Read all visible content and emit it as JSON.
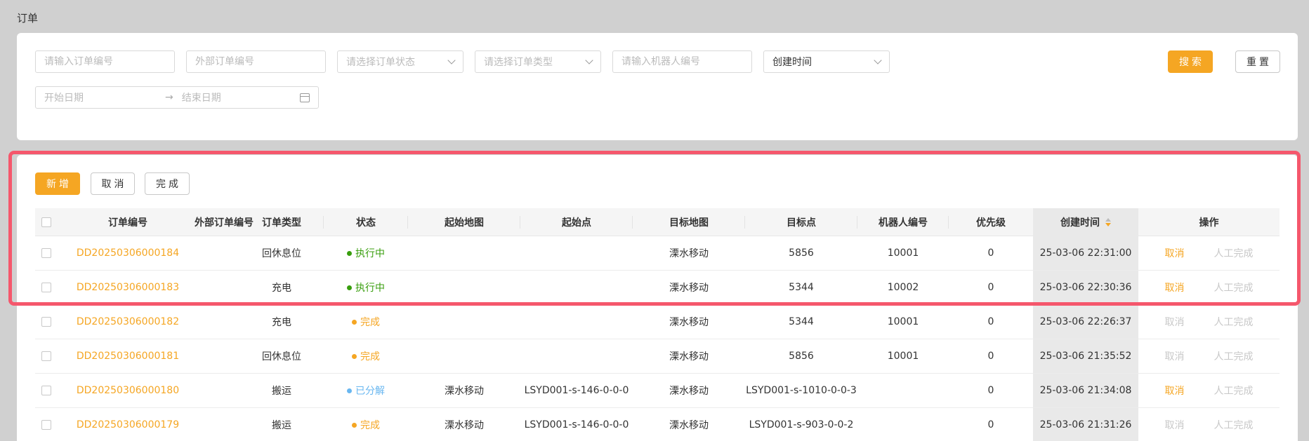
{
  "page_title": "订单",
  "filters": {
    "order_no_placeholder": "请输入订单编号",
    "external_no_placeholder": "外部订单编号",
    "status_placeholder": "请选择订单状态",
    "type_placeholder": "请选择订单类型",
    "robot_placeholder": "请输入机器人编号",
    "time_field_value": "创建时间",
    "start_date_placeholder": "开始日期",
    "date_separator": "→",
    "end_date_placeholder": "结束日期",
    "search_label": "搜索",
    "reset_label": "重置"
  },
  "toolbar": {
    "add_label": "新增",
    "cancel_label": "取消",
    "complete_label": "完成"
  },
  "table": {
    "columns": [
      "订单编号",
      "外部订单编号",
      "订单类型",
      "状态",
      "起始地图",
      "起始点",
      "目标地图",
      "目标点",
      "机器人编号",
      "优先级",
      "创建时间",
      "操作"
    ],
    "rows": [
      {
        "order_no": "DD20250306000184",
        "external_no": "",
        "type": "回休息位",
        "status": "执行中",
        "status_color": "#389e0d",
        "start_map": "",
        "start_point": "",
        "target_map": "溧水移动",
        "target_point": "5856",
        "robot": "10001",
        "priority": "0",
        "created": "25-03-06 22:31:00",
        "cancel": "取消",
        "cancel_enabled": true,
        "manual": "人工完成"
      },
      {
        "order_no": "DD20250306000183",
        "external_no": "",
        "type": "充电",
        "status": "执行中",
        "status_color": "#389e0d",
        "start_map": "",
        "start_point": "",
        "target_map": "溧水移动",
        "target_point": "5344",
        "robot": "10002",
        "priority": "0",
        "created": "25-03-06 22:30:36",
        "cancel": "取消",
        "cancel_enabled": true,
        "manual": "人工完成"
      },
      {
        "order_no": "DD20250306000182",
        "external_no": "",
        "type": "充电",
        "status": "完成",
        "status_color": "#f5a623",
        "start_map": "",
        "start_point": "",
        "target_map": "溧水移动",
        "target_point": "5344",
        "robot": "10001",
        "priority": "0",
        "created": "25-03-06 22:26:37",
        "cancel": "取消",
        "cancel_enabled": false,
        "manual": "人工完成"
      },
      {
        "order_no": "DD20250306000181",
        "external_no": "",
        "type": "回休息位",
        "status": "完成",
        "status_color": "#f5a623",
        "start_map": "",
        "start_point": "",
        "target_map": "溧水移动",
        "target_point": "5856",
        "robot": "10001",
        "priority": "0",
        "created": "25-03-06 21:35:52",
        "cancel": "取消",
        "cancel_enabled": false,
        "manual": "人工完成"
      },
      {
        "order_no": "DD20250306000180",
        "external_no": "",
        "type": "搬运",
        "status": "已分解",
        "status_color": "#69b7f0",
        "start_map": "溧水移动",
        "start_point": "LSYD001-s-146-0-0-0",
        "target_map": "溧水移动",
        "target_point": "LSYD001-s-1010-0-0-3",
        "robot": "",
        "priority": "0",
        "created": "25-03-06 21:34:08",
        "cancel": "取消",
        "cancel_enabled": true,
        "manual": "人工完成"
      },
      {
        "order_no": "DD20250306000179",
        "external_no": "",
        "type": "搬运",
        "status": "完成",
        "status_color": "#f5a623",
        "start_map": "溧水移动",
        "start_point": "LSYD001-s-146-0-0-0",
        "target_map": "溧水移动",
        "target_point": "LSYD001-s-903-0-0-2",
        "robot": "",
        "priority": "0",
        "created": "25-03-06 21:31:26",
        "cancel": "取消",
        "cancel_enabled": false,
        "manual": "人工完成"
      }
    ]
  },
  "colors": {
    "accent": "#f5a623",
    "highlight": "#f5576c"
  }
}
